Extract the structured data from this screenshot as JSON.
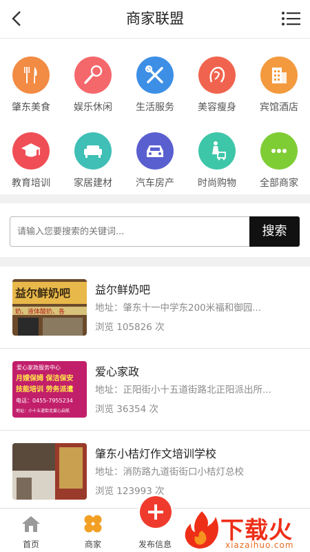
{
  "header": {
    "title": "商家联盟"
  },
  "categories": [
    {
      "label": "肇东美食",
      "icon": "cutlery-icon",
      "color": "#f28b43"
    },
    {
      "label": "娱乐休闲",
      "icon": "microphone-icon",
      "color": "#f4686c"
    },
    {
      "label": "生活服务",
      "icon": "tools-icon",
      "color": "#3d8fe6"
    },
    {
      "label": "美容瘦身",
      "icon": "woman-face-icon",
      "color": "#f0644f"
    },
    {
      "label": "宾馆酒店",
      "icon": "building-icon",
      "color": "#f39a3f"
    },
    {
      "label": "教育培训",
      "icon": "graduation-cap-icon",
      "color": "#f04e57"
    },
    {
      "label": "家居建材",
      "icon": "sofa-icon",
      "color": "#3fbfb6"
    },
    {
      "label": "汽车房产",
      "icon": "car-icon",
      "color": "#5a5fcf"
    },
    {
      "label": "时尚购物",
      "icon": "shopping-cart-icon",
      "color": "#3ec6a9"
    },
    {
      "label": "全部商家",
      "icon": "more-dots-icon",
      "color": "#7fcd35"
    }
  ],
  "search": {
    "placeholder": "请输入您要搜索的关键词...",
    "button": "搜索"
  },
  "listings": [
    {
      "name": "益尔鲜奶吧",
      "address": "地址：肇东十一中学东200米福和御园...",
      "views": "浏览 105826 次",
      "sign_line1": "益尔鲜奶吧",
      "sign_line2": "奶、液体酸奶、各"
    },
    {
      "name": "爱心家政",
      "address": "地址：正阳街小十五道街路北正阳派出所...",
      "views": "浏览 36354 次",
      "sign_line1": "爱心家政服务中心",
      "sign_line2": "月嫂保姆 保洁保安",
      "sign_line3": "技能培训 劳务派遣",
      "sign_line4": "电话：0455-7955234",
      "sign_line5": "地址：小十五道街北爱心启航"
    },
    {
      "name": "肇东小桔灯作文培训学校",
      "address": "地址：消防路九道街街口小桔灯总校",
      "views": "浏览 123993 次"
    }
  ],
  "tabs": [
    {
      "label": "首页",
      "icon": "home-icon"
    },
    {
      "label": "商家",
      "icon": "clover-icon"
    },
    {
      "label": "发布信息",
      "icon": "plus-icon"
    }
  ],
  "watermark": {
    "main": "下载火",
    "sub": "xiazaihuo.com"
  }
}
